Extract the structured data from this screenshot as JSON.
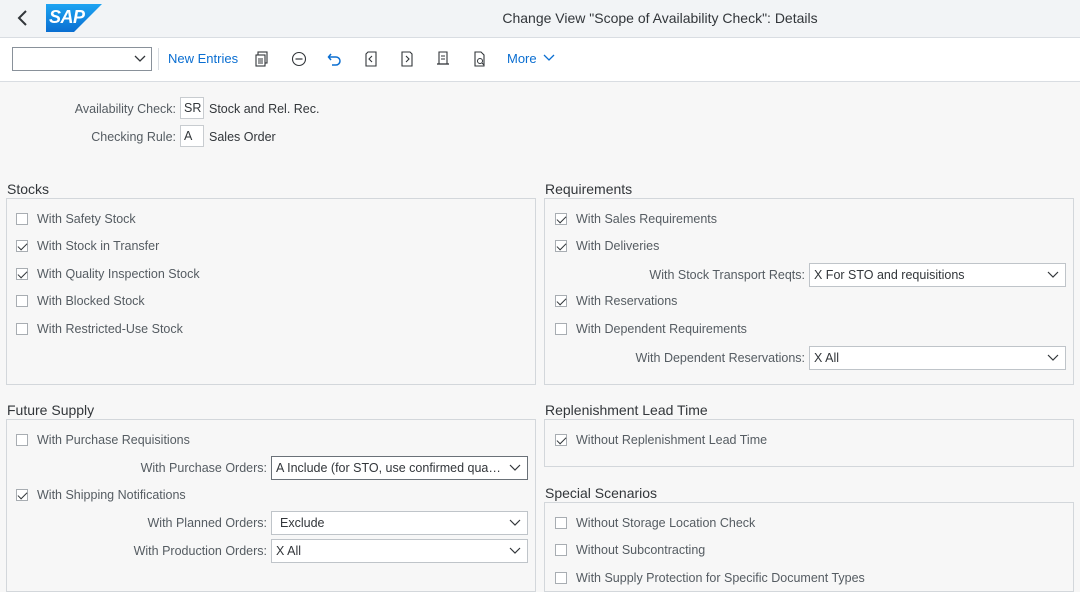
{
  "shell": {
    "logo_text": "SAP",
    "title": "Change View \"Scope of Availability Check\": Details"
  },
  "toolbar": {
    "select_value": "",
    "new_entries": "New Entries",
    "more": "More",
    "icons": [
      "copy-as-icon",
      "delete-icon",
      "undo-icon",
      "previous-entry-icon",
      "next-entry-icon",
      "export-icon",
      "print-icon"
    ]
  },
  "header": {
    "availability_check_label": "Availability Check:",
    "availability_check_code": "SR",
    "availability_check_text": "Stock and Rel. Rec.",
    "checking_rule_label": "Checking Rule:",
    "checking_rule_code": "A",
    "checking_rule_text": "Sales Order"
  },
  "stocks": {
    "title": "Stocks",
    "items": [
      {
        "label": "With Safety Stock",
        "checked": false
      },
      {
        "label": "With Stock in Transfer",
        "checked": true
      },
      {
        "label": "With Quality Inspection Stock",
        "checked": true
      },
      {
        "label": "With Blocked Stock",
        "checked": false
      },
      {
        "label": "With Restricted-Use Stock",
        "checked": false
      }
    ]
  },
  "requirements": {
    "title": "Requirements",
    "sales_requirements": {
      "label": "With Sales Requirements",
      "checked": true
    },
    "deliveries": {
      "label": "With Deliveries",
      "checked": true
    },
    "stock_transport_label": "With Stock Transport Reqts:",
    "stock_transport_value": "X For STO and requisitions",
    "reservations": {
      "label": "With Reservations",
      "checked": true
    },
    "dependent_requirements": {
      "label": "With Dependent Requirements",
      "checked": false
    },
    "dependent_reservations_label": "With Dependent Reservations:",
    "dependent_reservations_value": "X All"
  },
  "future_supply": {
    "title": "Future Supply",
    "purchase_requisitions": {
      "label": "With Purchase Requisitions",
      "checked": false
    },
    "purchase_orders_label": "With Purchase Orders:",
    "purchase_orders_value": "A Include (for STO, use confirmed quantit...",
    "shipping_notifications": {
      "label": "With Shipping Notifications",
      "checked": true
    },
    "planned_orders_label": "With Planned Orders:",
    "planned_orders_value": "Exclude",
    "production_orders_label": "With Production Orders:",
    "production_orders_value": "X All"
  },
  "replenishment": {
    "title": "Replenishment Lead Time",
    "without_lead_time": {
      "label": "Without Replenishment Lead Time",
      "checked": true
    }
  },
  "special": {
    "title": "Special Scenarios",
    "items": [
      {
        "label": "Without Storage Location Check",
        "checked": false
      },
      {
        "label": "Without Subcontracting",
        "checked": false
      },
      {
        "label": "With Supply Protection for Specific Document Types",
        "checked": false
      }
    ]
  }
}
